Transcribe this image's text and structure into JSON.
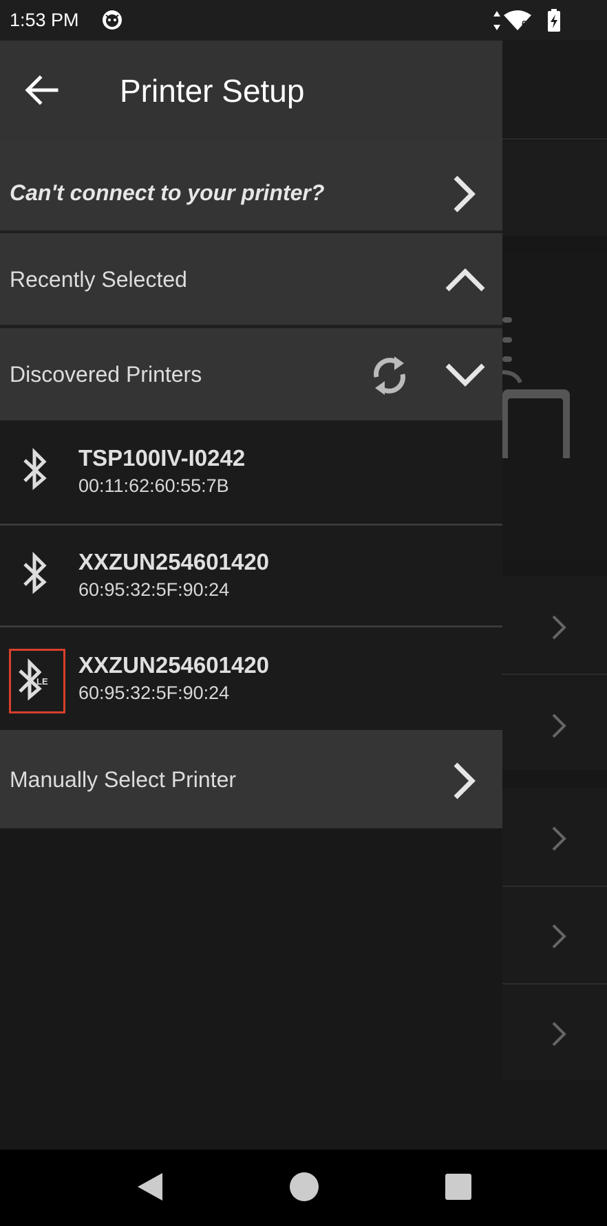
{
  "status_bar": {
    "time": "1:53 PM",
    "icons": [
      "app-notification-icon",
      "data-arrows-icon",
      "wifi-icon",
      "battery-charging-icon"
    ],
    "wifi_badge": "6"
  },
  "drawer": {
    "title": "Printer Setup",
    "back_icon": "arrow-left-icon",
    "cant_connect": {
      "label": "Can't connect to your printer?",
      "icon": "chevron-right-icon"
    },
    "recently_selected": {
      "label": "Recently Selected",
      "icon": "chevron-up-icon"
    },
    "discovered": {
      "label": "Discovered Printers",
      "refresh_icon": "refresh-icon",
      "toggle_icon": "chevron-down-icon"
    },
    "printers": [
      {
        "name": "TSP100IV-I0242",
        "mac": "00:11:62:60:55:7B",
        "icon": "bluetooth-icon"
      },
      {
        "name": "XXZUN254601420",
        "mac": "60:95:32:5F:90:24",
        "icon": "bluetooth-icon"
      },
      {
        "name": "XXZUN254601420",
        "mac": "60:95:32:5F:90:24",
        "icon": "bluetooth-le-icon",
        "icon_badge": "LE",
        "highlighted": true
      }
    ],
    "manual": {
      "label": "Manually Select Printer",
      "icon": "chevron-right-icon"
    }
  },
  "nav_bar": {
    "icons": [
      "back-triangle-icon",
      "home-circle-icon",
      "recents-square-icon"
    ]
  },
  "colors": {
    "drawer_row_bg": "#343434",
    "drawer_bg": "#181818",
    "highlight": "#d8402c",
    "text": "#dddddd"
  }
}
